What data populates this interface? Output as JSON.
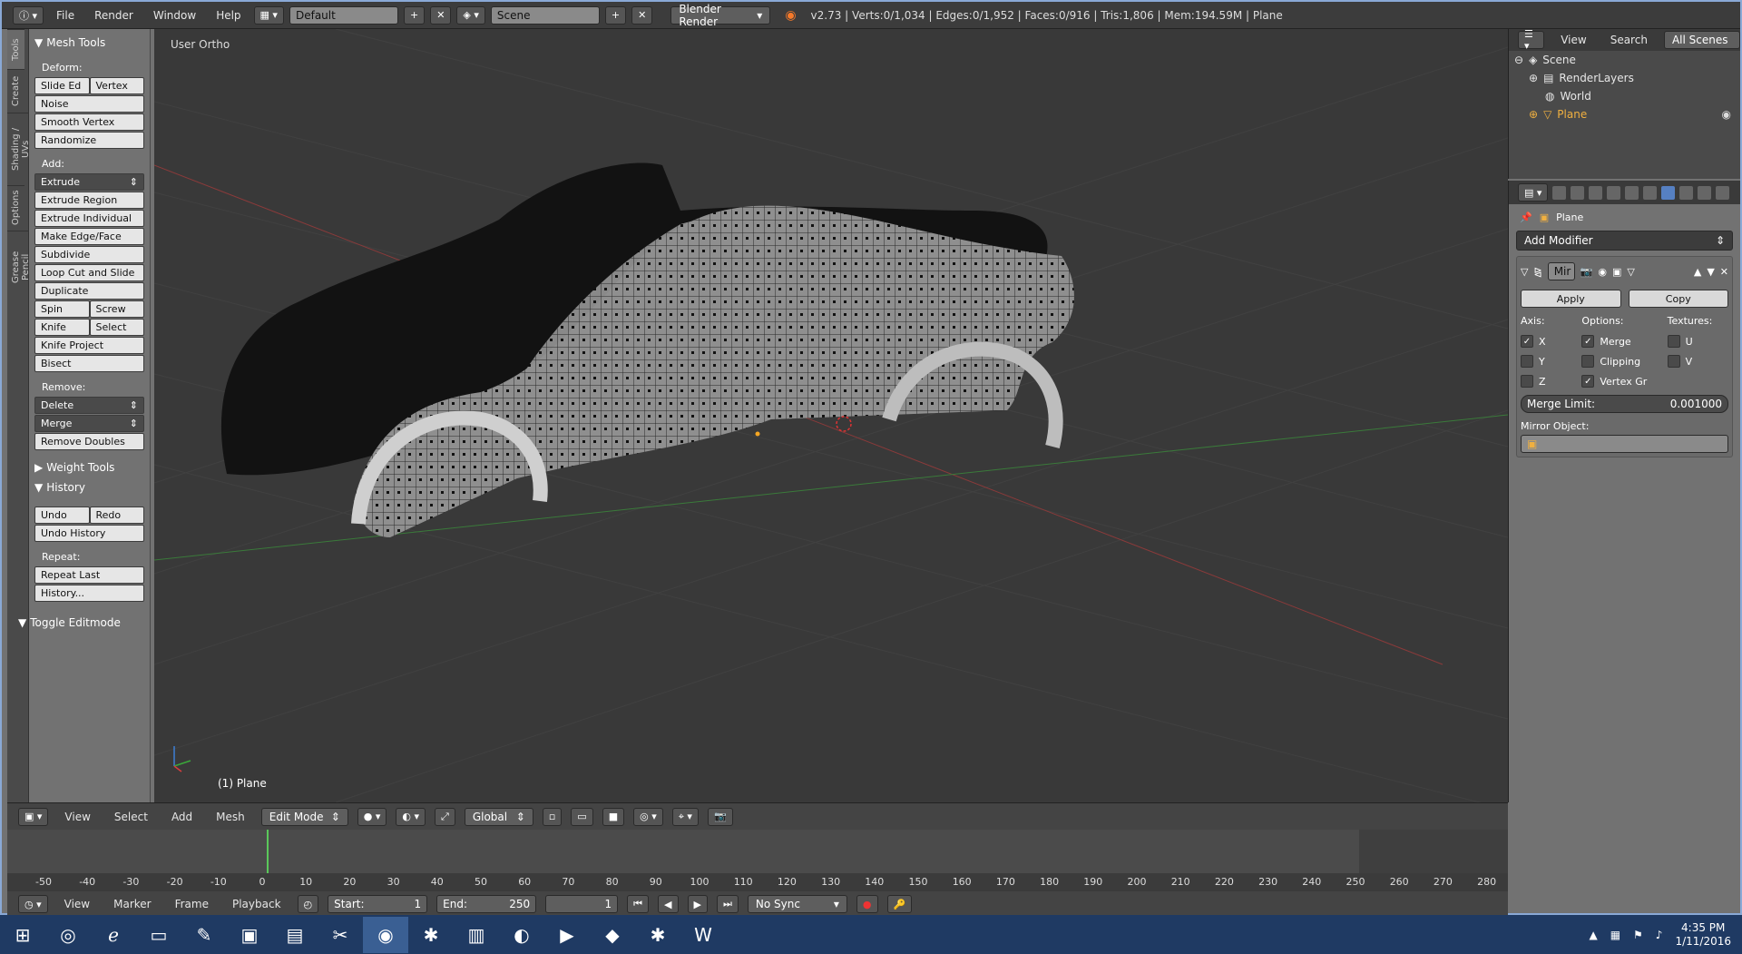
{
  "topbar": {
    "menus": [
      "File",
      "Render",
      "Window",
      "Help"
    ],
    "layout": "Default",
    "scene": "Scene",
    "engine": "Blender Render",
    "stats": "v2.73 | Verts:0/1,034 | Edges:0/1,952 | Faces:0/916 | Tris:1,806 | Mem:194.59M | Plane"
  },
  "lefttabs": [
    "Tools",
    "Create",
    "Shading / UVs",
    "Options",
    "Grease Pencil"
  ],
  "toolpanel": {
    "mesh_tools": "Mesh Tools",
    "deform_label": "Deform:",
    "slide_edge": "Slide Ed",
    "vertex": "Vertex",
    "noise": "Noise",
    "smooth_vertex": "Smooth Vertex",
    "randomize": "Randomize",
    "add_label": "Add:",
    "extrude": "Extrude",
    "extrude_region": "Extrude Region",
    "extrude_individual": "Extrude Individual",
    "make_edge_face": "Make Edge/Face",
    "subdivide": "Subdivide",
    "loop_cut": "Loop Cut and Slide",
    "duplicate": "Duplicate",
    "spin": "Spin",
    "screw": "Screw",
    "knife": "Knife",
    "select": "Select",
    "knife_project": "Knife Project",
    "bisect": "Bisect",
    "remove_label": "Remove:",
    "delete": "Delete",
    "merge": "Merge",
    "remove_doubles": "Remove Doubles",
    "weight_tools": "Weight Tools",
    "history": "History",
    "undo": "Undo",
    "redo": "Redo",
    "undo_history": "Undo History",
    "repeat_label": "Repeat:",
    "repeat_last": "Repeat Last",
    "history_dots": "History...",
    "toggle_editmode": "Toggle Editmode"
  },
  "viewport": {
    "label": "User Ortho",
    "object": "(1) Plane"
  },
  "v3dheader": {
    "menus": [
      "View",
      "Select",
      "Add",
      "Mesh"
    ],
    "mode": "Edit Mode",
    "orientation": "Global"
  },
  "timeline": {
    "ticks": [
      "-50",
      "-40",
      "-30",
      "-20",
      "-10",
      "0",
      "10",
      "20",
      "30",
      "40",
      "50",
      "60",
      "70",
      "80",
      "90",
      "100",
      "110",
      "120",
      "130",
      "140",
      "150",
      "160",
      "170",
      "180",
      "190",
      "200",
      "210",
      "220",
      "230",
      "240",
      "250",
      "260",
      "270",
      "280"
    ],
    "menus": [
      "View",
      "Marker",
      "Frame",
      "Playback"
    ],
    "start_label": "Start:",
    "start_value": "1",
    "end_label": "End:",
    "end_value": "250",
    "current": "1",
    "sync": "No Sync"
  },
  "outliner": {
    "menus": [
      "View",
      "Search"
    ],
    "filter": "All Scenes",
    "items": [
      "Scene",
      "RenderLayers",
      "World",
      "Plane"
    ]
  },
  "props": {
    "object_name": "Plane",
    "add_modifier": "Add Modifier",
    "mod_name": "Mir",
    "apply": "Apply",
    "copy": "Copy",
    "axis_label": "Axis:",
    "options_label": "Options:",
    "textures_label": "Textures:",
    "x": "X",
    "y": "Y",
    "z": "Z",
    "merge": "Merge",
    "clipping": "Clipping",
    "vertex_gr": "Vertex Gr",
    "u": "U",
    "v": "V",
    "merge_limit_label": "Merge Limit:",
    "merge_limit_value": "0.001000",
    "mirror_object": "Mirror Object:"
  },
  "taskbar": {
    "time": "4:35 PM",
    "date": "1/11/2016"
  }
}
